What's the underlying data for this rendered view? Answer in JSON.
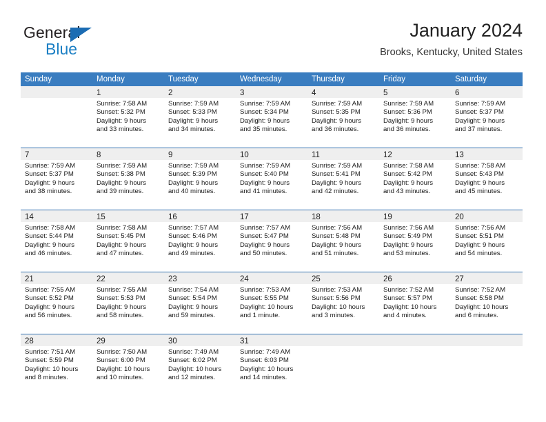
{
  "brand": {
    "name_dark": "General",
    "name_blue": "Blue"
  },
  "header": {
    "title": "January 2024",
    "subtitle": "Brooks, Kentucky, United States"
  },
  "colors": {
    "header_blue": "#3a7dc0",
    "separator_blue": "#2f6fb0",
    "day_band_gray": "#efefef",
    "brand_blue": "#1b7fc4"
  },
  "weekdays": [
    "Sunday",
    "Monday",
    "Tuesday",
    "Wednesday",
    "Thursday",
    "Friday",
    "Saturday"
  ],
  "labels": {
    "sunrise": "Sunrise:",
    "sunset": "Sunset:",
    "daylight": "Daylight:"
  },
  "weeks": [
    [
      {
        "day": "",
        "sunrise": "",
        "sunset": "",
        "daylight_1": "",
        "daylight_2": ""
      },
      {
        "day": "1",
        "sunrise": "Sunrise: 7:58 AM",
        "sunset": "Sunset: 5:32 PM",
        "daylight_1": "Daylight: 9 hours",
        "daylight_2": "and 33 minutes."
      },
      {
        "day": "2",
        "sunrise": "Sunrise: 7:59 AM",
        "sunset": "Sunset: 5:33 PM",
        "daylight_1": "Daylight: 9 hours",
        "daylight_2": "and 34 minutes."
      },
      {
        "day": "3",
        "sunrise": "Sunrise: 7:59 AM",
        "sunset": "Sunset: 5:34 PM",
        "daylight_1": "Daylight: 9 hours",
        "daylight_2": "and 35 minutes."
      },
      {
        "day": "4",
        "sunrise": "Sunrise: 7:59 AM",
        "sunset": "Sunset: 5:35 PM",
        "daylight_1": "Daylight: 9 hours",
        "daylight_2": "and 36 minutes."
      },
      {
        "day": "5",
        "sunrise": "Sunrise: 7:59 AM",
        "sunset": "Sunset: 5:36 PM",
        "daylight_1": "Daylight: 9 hours",
        "daylight_2": "and 36 minutes."
      },
      {
        "day": "6",
        "sunrise": "Sunrise: 7:59 AM",
        "sunset": "Sunset: 5:37 PM",
        "daylight_1": "Daylight: 9 hours",
        "daylight_2": "and 37 minutes."
      }
    ],
    [
      {
        "day": "7",
        "sunrise": "Sunrise: 7:59 AM",
        "sunset": "Sunset: 5:37 PM",
        "daylight_1": "Daylight: 9 hours",
        "daylight_2": "and 38 minutes."
      },
      {
        "day": "8",
        "sunrise": "Sunrise: 7:59 AM",
        "sunset": "Sunset: 5:38 PM",
        "daylight_1": "Daylight: 9 hours",
        "daylight_2": "and 39 minutes."
      },
      {
        "day": "9",
        "sunrise": "Sunrise: 7:59 AM",
        "sunset": "Sunset: 5:39 PM",
        "daylight_1": "Daylight: 9 hours",
        "daylight_2": "and 40 minutes."
      },
      {
        "day": "10",
        "sunrise": "Sunrise: 7:59 AM",
        "sunset": "Sunset: 5:40 PM",
        "daylight_1": "Daylight: 9 hours",
        "daylight_2": "and 41 minutes."
      },
      {
        "day": "11",
        "sunrise": "Sunrise: 7:59 AM",
        "sunset": "Sunset: 5:41 PM",
        "daylight_1": "Daylight: 9 hours",
        "daylight_2": "and 42 minutes."
      },
      {
        "day": "12",
        "sunrise": "Sunrise: 7:58 AM",
        "sunset": "Sunset: 5:42 PM",
        "daylight_1": "Daylight: 9 hours",
        "daylight_2": "and 43 minutes."
      },
      {
        "day": "13",
        "sunrise": "Sunrise: 7:58 AM",
        "sunset": "Sunset: 5:43 PM",
        "daylight_1": "Daylight: 9 hours",
        "daylight_2": "and 45 minutes."
      }
    ],
    [
      {
        "day": "14",
        "sunrise": "Sunrise: 7:58 AM",
        "sunset": "Sunset: 5:44 PM",
        "daylight_1": "Daylight: 9 hours",
        "daylight_2": "and 46 minutes."
      },
      {
        "day": "15",
        "sunrise": "Sunrise: 7:58 AM",
        "sunset": "Sunset: 5:45 PM",
        "daylight_1": "Daylight: 9 hours",
        "daylight_2": "and 47 minutes."
      },
      {
        "day": "16",
        "sunrise": "Sunrise: 7:57 AM",
        "sunset": "Sunset: 5:46 PM",
        "daylight_1": "Daylight: 9 hours",
        "daylight_2": "and 49 minutes."
      },
      {
        "day": "17",
        "sunrise": "Sunrise: 7:57 AM",
        "sunset": "Sunset: 5:47 PM",
        "daylight_1": "Daylight: 9 hours",
        "daylight_2": "and 50 minutes."
      },
      {
        "day": "18",
        "sunrise": "Sunrise: 7:56 AM",
        "sunset": "Sunset: 5:48 PM",
        "daylight_1": "Daylight: 9 hours",
        "daylight_2": "and 51 minutes."
      },
      {
        "day": "19",
        "sunrise": "Sunrise: 7:56 AM",
        "sunset": "Sunset: 5:49 PM",
        "daylight_1": "Daylight: 9 hours",
        "daylight_2": "and 53 minutes."
      },
      {
        "day": "20",
        "sunrise": "Sunrise: 7:56 AM",
        "sunset": "Sunset: 5:51 PM",
        "daylight_1": "Daylight: 9 hours",
        "daylight_2": "and 54 minutes."
      }
    ],
    [
      {
        "day": "21",
        "sunrise": "Sunrise: 7:55 AM",
        "sunset": "Sunset: 5:52 PM",
        "daylight_1": "Daylight: 9 hours",
        "daylight_2": "and 56 minutes."
      },
      {
        "day": "22",
        "sunrise": "Sunrise: 7:55 AM",
        "sunset": "Sunset: 5:53 PM",
        "daylight_1": "Daylight: 9 hours",
        "daylight_2": "and 58 minutes."
      },
      {
        "day": "23",
        "sunrise": "Sunrise: 7:54 AM",
        "sunset": "Sunset: 5:54 PM",
        "daylight_1": "Daylight: 9 hours",
        "daylight_2": "and 59 minutes."
      },
      {
        "day": "24",
        "sunrise": "Sunrise: 7:53 AM",
        "sunset": "Sunset: 5:55 PM",
        "daylight_1": "Daylight: 10 hours",
        "daylight_2": "and 1 minute."
      },
      {
        "day": "25",
        "sunrise": "Sunrise: 7:53 AM",
        "sunset": "Sunset: 5:56 PM",
        "daylight_1": "Daylight: 10 hours",
        "daylight_2": "and 3 minutes."
      },
      {
        "day": "26",
        "sunrise": "Sunrise: 7:52 AM",
        "sunset": "Sunset: 5:57 PM",
        "daylight_1": "Daylight: 10 hours",
        "daylight_2": "and 4 minutes."
      },
      {
        "day": "27",
        "sunrise": "Sunrise: 7:52 AM",
        "sunset": "Sunset: 5:58 PM",
        "daylight_1": "Daylight: 10 hours",
        "daylight_2": "and 6 minutes."
      }
    ],
    [
      {
        "day": "28",
        "sunrise": "Sunrise: 7:51 AM",
        "sunset": "Sunset: 5:59 PM",
        "daylight_1": "Daylight: 10 hours",
        "daylight_2": "and 8 minutes."
      },
      {
        "day": "29",
        "sunrise": "Sunrise: 7:50 AM",
        "sunset": "Sunset: 6:00 PM",
        "daylight_1": "Daylight: 10 hours",
        "daylight_2": "and 10 minutes."
      },
      {
        "day": "30",
        "sunrise": "Sunrise: 7:49 AM",
        "sunset": "Sunset: 6:02 PM",
        "daylight_1": "Daylight: 10 hours",
        "daylight_2": "and 12 minutes."
      },
      {
        "day": "31",
        "sunrise": "Sunrise: 7:49 AM",
        "sunset": "Sunset: 6:03 PM",
        "daylight_1": "Daylight: 10 hours",
        "daylight_2": "and 14 minutes."
      },
      {
        "day": "",
        "sunrise": "",
        "sunset": "",
        "daylight_1": "",
        "daylight_2": ""
      },
      {
        "day": "",
        "sunrise": "",
        "sunset": "",
        "daylight_1": "",
        "daylight_2": ""
      },
      {
        "day": "",
        "sunrise": "",
        "sunset": "",
        "daylight_1": "",
        "daylight_2": ""
      }
    ]
  ]
}
